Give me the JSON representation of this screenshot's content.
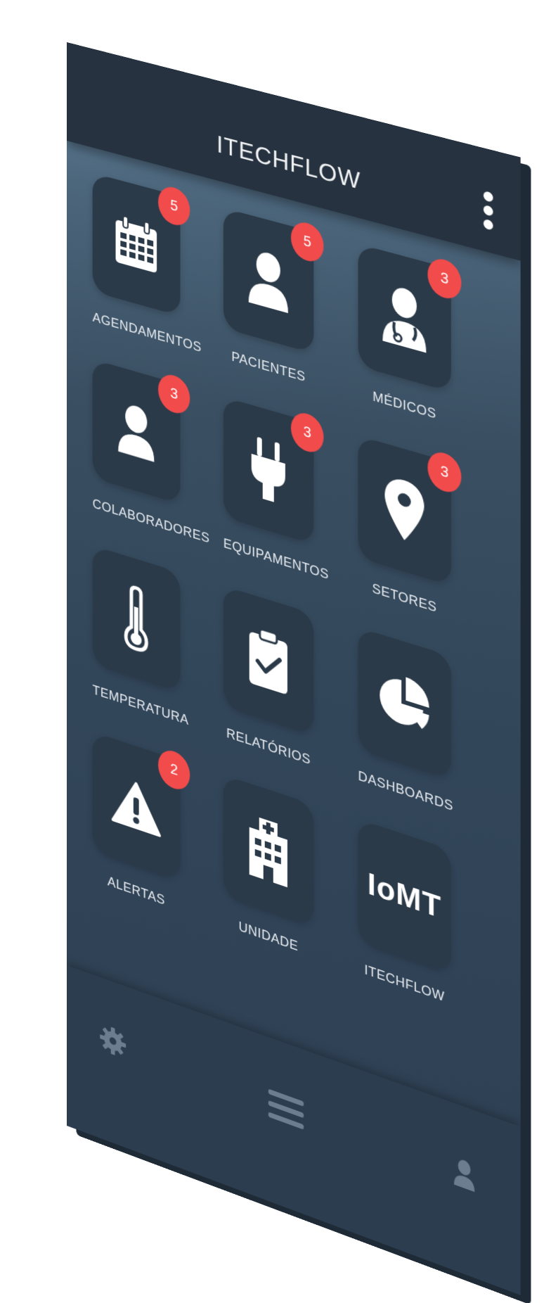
{
  "header": {
    "title": "ITECHFLOW"
  },
  "tiles": [
    {
      "label": "AGENDAMENTOS",
      "badge": "5",
      "icon": "calendar-icon"
    },
    {
      "label": "PACIENTES",
      "badge": "5",
      "icon": "user-icon"
    },
    {
      "label": "MÉDICOS",
      "badge": "3",
      "icon": "doctor-icon"
    },
    {
      "label": "COLABORADORES",
      "badge": "3",
      "icon": "user-icon"
    },
    {
      "label": "EQUIPAMENTOS",
      "badge": "3",
      "icon": "plug-icon"
    },
    {
      "label": "SETORES",
      "badge": "3",
      "icon": "map-pin-icon"
    },
    {
      "label": "TEMPERATURA",
      "icon": "thermometer-icon"
    },
    {
      "label": "RELATÓRIOS",
      "icon": "clipboard-check-icon"
    },
    {
      "label": "DASHBOARDS",
      "icon": "pie-chart-icon"
    },
    {
      "label": "ALERTAS",
      "badge": "2",
      "icon": "warning-icon"
    },
    {
      "label": "UNIDADE",
      "icon": "hospital-icon"
    },
    {
      "label": "ITECHFLOW",
      "icon": "iomt-logo",
      "icon_text": "IoMT"
    }
  ],
  "bottom_bar": {
    "left_icon": "gear-icon",
    "center_icon": "hamburger-menu-icon",
    "right_icon": "user-icon"
  },
  "colors": {
    "header": "#26323f",
    "tile": "#2b3a49",
    "badge": "#f14b4b",
    "text": "#e9edf1"
  }
}
